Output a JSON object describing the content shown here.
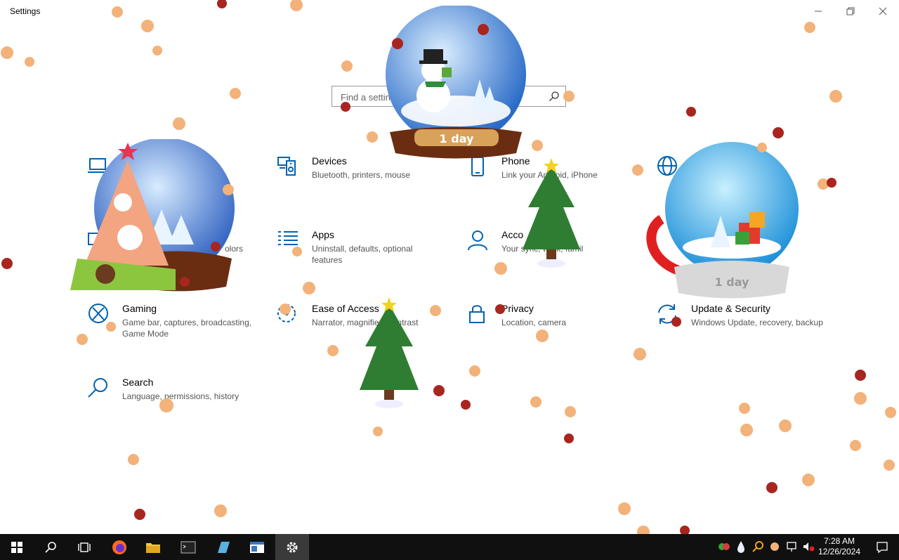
{
  "window": {
    "title": "Settings"
  },
  "search": {
    "placeholder": "Find a setting"
  },
  "tiles": [
    {
      "title": "",
      "desc": "",
      "icon": "laptop-icon"
    },
    {
      "title": "Devices",
      "desc": "Bluetooth, printers, mouse",
      "icon": "keyboard-speaker-icon"
    },
    {
      "title": "Phone",
      "desc": "Link your Android, iPhone",
      "icon": "phone-icon"
    },
    {
      "title": "",
      "desc": "",
      "icon": "globe-icon"
    },
    {
      "title": "",
      "desc": "olors",
      "icon": "personalization-icon"
    },
    {
      "title": "Apps",
      "desc": "Uninstall, defaults, optional features",
      "icon": "apps-list-icon"
    },
    {
      "title": "Acco",
      "desc": "Your  sync, work, famil",
      "icon": "person-icon"
    },
    {
      "title": "Gaming",
      "desc": "Game bar, captures, broadcasting, Game Mode",
      "icon": "xbox-icon"
    },
    {
      "title": "Ease of Access",
      "desc": "Narrator, magnifie h contrast",
      "icon": "ease-of-access-icon"
    },
    {
      "title": "Privacy",
      "desc": "Location, camera",
      "icon": "lock-icon"
    },
    {
      "title": "Update & Security",
      "desc": "Windows Update, recovery, backup",
      "icon": "sync-icon"
    },
    {
      "title": "Search",
      "desc": "Language, permissions, history",
      "icon": "search-icon"
    }
  ],
  "decorations": {
    "globe_top_label": "1 day",
    "globe_right_label": "1 day"
  },
  "taskbar": {
    "time": "7:28 AM",
    "date": "12/26/2024",
    "items": [
      "windows-start-icon",
      "search-icon",
      "task-view-icon",
      "firefox-icon",
      "file-explorer-icon",
      "terminal-icon",
      "notepad-icon",
      "app-window-icon",
      "settings-gear-icon"
    ]
  },
  "colors": {
    "accent": "#0063b1",
    "taskbar": "#101010",
    "active_task": "#3a3a3a"
  }
}
